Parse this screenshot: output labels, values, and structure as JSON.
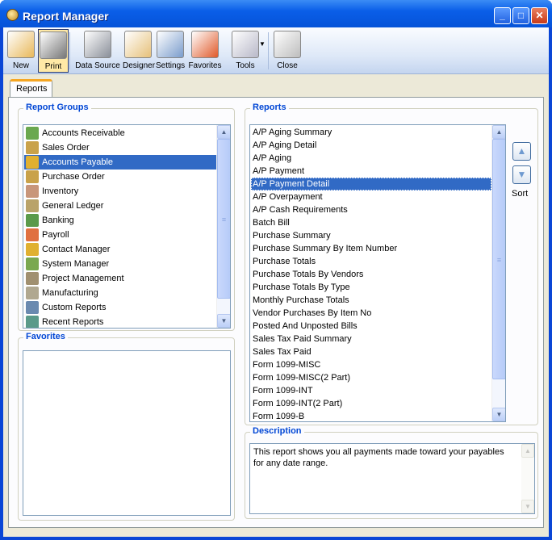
{
  "window": {
    "title": "Report Manager",
    "minimize": "_",
    "maximize": "□",
    "close": "✕"
  },
  "toolbar": {
    "items": [
      {
        "label": "New",
        "icon": "new-report-icon"
      },
      {
        "label": "Print",
        "icon": "printer-icon",
        "active": true
      },
      {
        "label": "Data Source",
        "icon": "database-icon"
      },
      {
        "label": "Designer",
        "icon": "designer-icon"
      },
      {
        "label": "Settings",
        "icon": "settings-icon"
      },
      {
        "label": "Favorites",
        "icon": "favorites-heart-icon"
      },
      {
        "label": "Tools",
        "icon": "tools-icon"
      },
      {
        "label": "Close",
        "icon": "close-window-icon"
      }
    ]
  },
  "tabs": [
    {
      "label": "Reports",
      "active": true
    }
  ],
  "report_groups": {
    "label": "Report Groups",
    "selected": "Accounts Payable",
    "items": [
      {
        "label": "Accounts Receivable",
        "color": "#6aa84f"
      },
      {
        "label": "Sales Order",
        "color": "#c9a24a"
      },
      {
        "label": "Accounts Payable",
        "color": "#e0b030"
      },
      {
        "label": "Purchase Order",
        "color": "#c9a24a"
      },
      {
        "label": "Inventory",
        "color": "#c8967a"
      },
      {
        "label": "General Ledger",
        "color": "#b9a36a"
      },
      {
        "label": "Banking",
        "color": "#5a9a4a"
      },
      {
        "label": "Payroll",
        "color": "#e07040"
      },
      {
        "label": "Contact Manager",
        "color": "#e0b030"
      },
      {
        "label": "System Manager",
        "color": "#7aa850"
      },
      {
        "label": "Project Management",
        "color": "#a09070"
      },
      {
        "label": "Manufacturing",
        "color": "#b0a890"
      },
      {
        "label": "Custom Reports",
        "color": "#6a8ab0"
      },
      {
        "label": "Recent Reports",
        "color": "#5a9a8a"
      }
    ]
  },
  "favorites": {
    "label": "Favorites",
    "items": []
  },
  "reports": {
    "label": "Reports",
    "selected": "A/P Payment Detail",
    "items": [
      "A/P Aging Summary",
      "A/P Aging Detail",
      "A/P Aging",
      "A/P Payment",
      "A/P Payment Detail",
      "A/P Overpayment",
      "A/P Cash Requirements",
      "Batch Bill",
      "Purchase Summary",
      "Purchase Summary By Item Number",
      "Purchase Totals",
      "Purchase Totals By Vendors",
      "Purchase Totals By Type",
      "Monthly Purchase Totals",
      "Vendor Purchases By Item No",
      "Posted And Unposted Bills",
      "Sales Tax Paid Summary",
      "Sales Tax Paid",
      "Form 1099-MISC",
      "Form 1099-MISC(2 Part)",
      "Form 1099-INT",
      "Form 1099-INT(2 Part)",
      "Form 1099-B"
    ]
  },
  "sort": {
    "label": "Sort",
    "up": "▲",
    "down": "▼"
  },
  "description": {
    "label": "Description",
    "text": "This report shows you all payments made toward your payables for any date range."
  },
  "scroll": {
    "up": "▲",
    "down": "▼",
    "grip": "≡"
  },
  "colors": {
    "selection": "#316ac5",
    "group_label": "#0046d5",
    "title_bar": "#0a5ee8"
  }
}
